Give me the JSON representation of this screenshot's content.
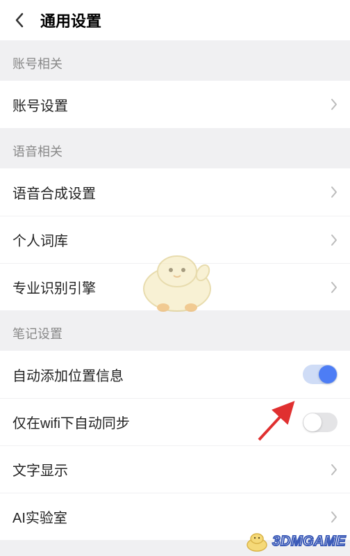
{
  "header": {
    "title": "通用设置"
  },
  "sections": {
    "account": {
      "header": "账号相关",
      "items": {
        "account_settings": "账号设置"
      }
    },
    "voice": {
      "header": "语音相关",
      "items": {
        "tts_settings": "语音合成设置",
        "personal_dict": "个人词库",
        "pro_engine": "专业识别引擎"
      }
    },
    "notes": {
      "header": "笔记设置",
      "items": {
        "auto_location": "自动添加位置信息",
        "wifi_sync": "仅在wifi下自动同步",
        "text_display": "文字显示",
        "ai_lab": "AI实验室"
      }
    }
  },
  "toggles": {
    "auto_location": true,
    "wifi_sync": false
  },
  "watermark": {
    "text": "3DMGAME"
  }
}
